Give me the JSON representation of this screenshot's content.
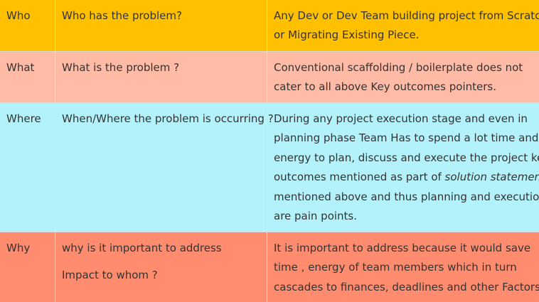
{
  "rows": [
    {
      "key": "Who",
      "question": "Who has the problem?",
      "answer_lines": [
        "Any Dev or Dev Team building project from Scratch",
        "or Migrating Existing Piece."
      ],
      "bg_color": "#ffc000"
    },
    {
      "key": "What",
      "question": "What is the problem ?",
      "answer_lines": [
        "Conventional scaffolding / boilerplate does not",
        "cater to all above Key outcomes pointers."
      ],
      "bg_color": "#ffbba5"
    },
    {
      "key": "Where",
      "question": "When/Where the problem is occurring ?",
      "answer_lines": [
        "During any project execution stage and even in",
        "planning phase  Team Has to spend a lot time and",
        "energy to plan, discuss and execute the project key",
        "outcomes mentioned as part of ",
        "mentioned above and thus planning and execution",
        "are pain points."
      ],
      "answer_emphasis": "solution statement",
      "bg_color": "#b3f2fb"
    },
    {
      "key": "Why",
      "question": "why is it important to address",
      "question_extra": "Impact to whom ?",
      "answer_lines": [
        "It is important to address because it would save",
        "time , energy of team members which in turn",
        "cascades  to finances, deadlines and other Factors."
      ],
      "bg_color": "#ff8c6e"
    }
  ]
}
